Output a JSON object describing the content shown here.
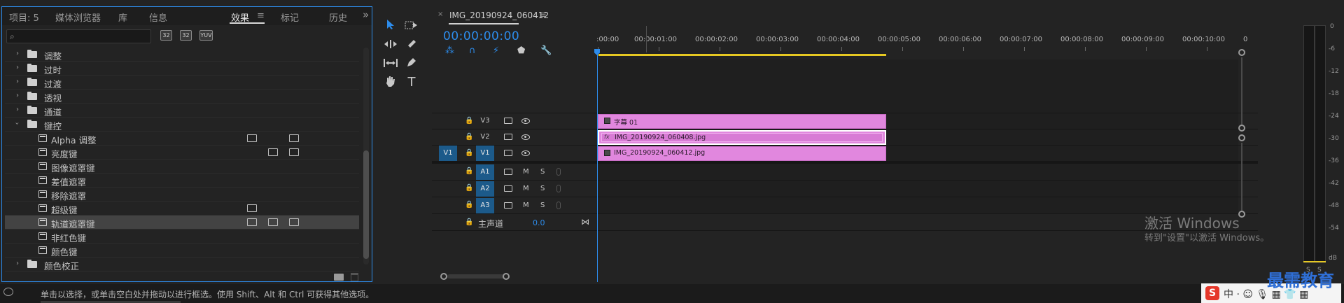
{
  "effects_panel": {
    "tabs": [
      {
        "label": "项目: 5"
      },
      {
        "label": "媒体浏览器"
      },
      {
        "label": "库"
      },
      {
        "label": "信息"
      },
      {
        "label": "效果"
      },
      {
        "label": "标记"
      },
      {
        "label": "历史"
      }
    ],
    "active_tab": "效果",
    "menu_glyph": "≡",
    "overflow_glyph": "»",
    "search_placeholder": "",
    "filter_buttons": [
      "32",
      "32",
      "YUV"
    ],
    "tree": [
      {
        "label": "调整",
        "type": "folder"
      },
      {
        "label": "过时",
        "type": "folder"
      },
      {
        "label": "过渡",
        "type": "folder"
      },
      {
        "label": "透视",
        "type": "folder"
      },
      {
        "label": "通道",
        "type": "folder"
      },
      {
        "label": "键控",
        "type": "folder",
        "expanded": true
      },
      {
        "label": "Alpha 调整",
        "type": "effect"
      },
      {
        "label": "亮度键",
        "type": "effect"
      },
      {
        "label": "图像遮罩键",
        "type": "effect"
      },
      {
        "label": "差值遮罩",
        "type": "effect"
      },
      {
        "label": "移除遮罩",
        "type": "effect"
      },
      {
        "label": "超级键",
        "type": "effect"
      },
      {
        "label": "轨道遮罩键",
        "type": "effect",
        "selected": true
      },
      {
        "label": "非红色键",
        "type": "effect"
      },
      {
        "label": "颜色键",
        "type": "effect"
      },
      {
        "label": "颜色校正",
        "type": "folder"
      }
    ]
  },
  "tools": {
    "items": [
      "selection-tool",
      "track-select-tool",
      "ripple-edit-tool",
      "razor-tool",
      "slip-tool",
      "pen-tool",
      "hand-tool",
      "type-tool"
    ],
    "type_glyph": "T"
  },
  "timeline": {
    "sequence_name": "IMG_20190924_060412",
    "close_glyph": "×",
    "menu_glyph": "≡",
    "timecode": "00:00:00:00",
    "ruler_labels": [
      ":00:00",
      "00:00:01:00",
      "00:00:02:00",
      "00:00:03:00",
      "00:00:04:00",
      "00:00:05:00",
      "00:00:06:00",
      "00:00:07:00",
      "00:00:08:00",
      "00:00:09:00",
      "00:00:10:00",
      "0"
    ],
    "video_tracks": [
      {
        "name": "V3",
        "clip": "字幕 01",
        "clip_kind": "title"
      },
      {
        "name": "V2",
        "clip": "IMG_20190924_060408.jpg",
        "clip_kind": "fx",
        "fx_label": "fx"
      },
      {
        "name": "V1",
        "clip": "IMG_20190924_060412.jpg",
        "clip_kind": "image",
        "source_patch": "V1"
      }
    ],
    "audio_tracks": [
      {
        "name": "A1",
        "m": "M",
        "s": "S"
      },
      {
        "name": "A2",
        "m": "M",
        "s": "S"
      },
      {
        "name": "A3",
        "m": "M",
        "s": "S"
      }
    ],
    "master": {
      "label": "主声道",
      "value": "0.0"
    },
    "watermark_title": "激活 Windows",
    "watermark_sub": "转到\"设置\"以激活 Windows。"
  },
  "meter": {
    "labels": [
      "0",
      "-6",
      "-12",
      "-18",
      "-24",
      "-30",
      "-36",
      "-42",
      "-48",
      "-54",
      "dB"
    ],
    "s_labels": [
      "S",
      "S"
    ],
    "peak_color": "#e6c822"
  },
  "status_bar": {
    "text": "单击以选择，或单击空白处并拖动以进行框选。使用 Shift、Alt 和 Ctrl 可获得其他选项。"
  },
  "ime": {
    "logo": "S",
    "text": "中 · ☺ 🎙 ▦ 👕 ▦"
  },
  "brand": {
    "text": "最需教育"
  },
  "colors": {
    "accent": "#2d8ceb",
    "clip": "#e187de",
    "work_area": "#e6c822",
    "track_target": "#1c5a8a"
  }
}
